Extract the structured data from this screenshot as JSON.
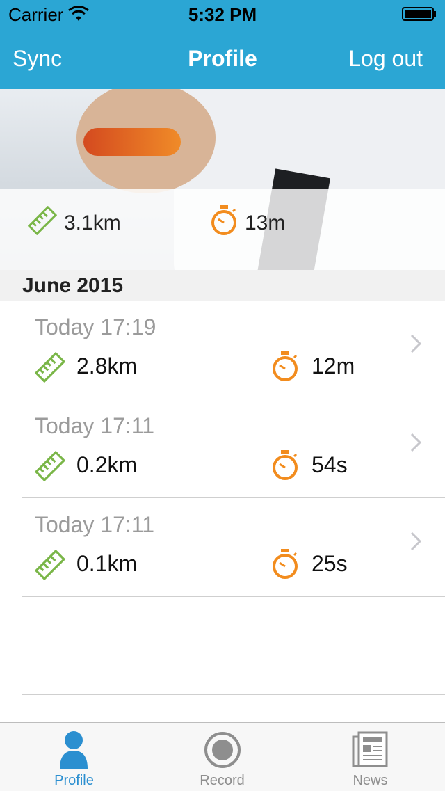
{
  "status_bar": {
    "carrier": "Carrier",
    "time": "5:32 PM"
  },
  "nav": {
    "left": "Sync",
    "title": "Profile",
    "right": "Log out"
  },
  "summary": {
    "distance": "3.1km",
    "duration": "13m"
  },
  "section": {
    "title": "June 2015"
  },
  "activities": [
    {
      "time": "Today 17:19",
      "distance": "2.8km",
      "duration": "12m"
    },
    {
      "time": "Today 17:11",
      "distance": "0.2km",
      "duration": "54s"
    },
    {
      "time": "Today 17:11",
      "distance": "0.1km",
      "duration": "25s"
    }
  ],
  "tabs": [
    {
      "label": "Profile",
      "icon": "person-icon",
      "active": true
    },
    {
      "label": "Record",
      "icon": "record-icon",
      "active": false
    },
    {
      "label": "News",
      "icon": "newspaper-icon",
      "active": false
    }
  ],
  "colors": {
    "header": "#2ba6d4",
    "distance_icon": "#7ab648",
    "timer_icon": "#f28c1e",
    "tab_active": "#2b8fd0",
    "tab_inactive": "#8e8e8e"
  }
}
